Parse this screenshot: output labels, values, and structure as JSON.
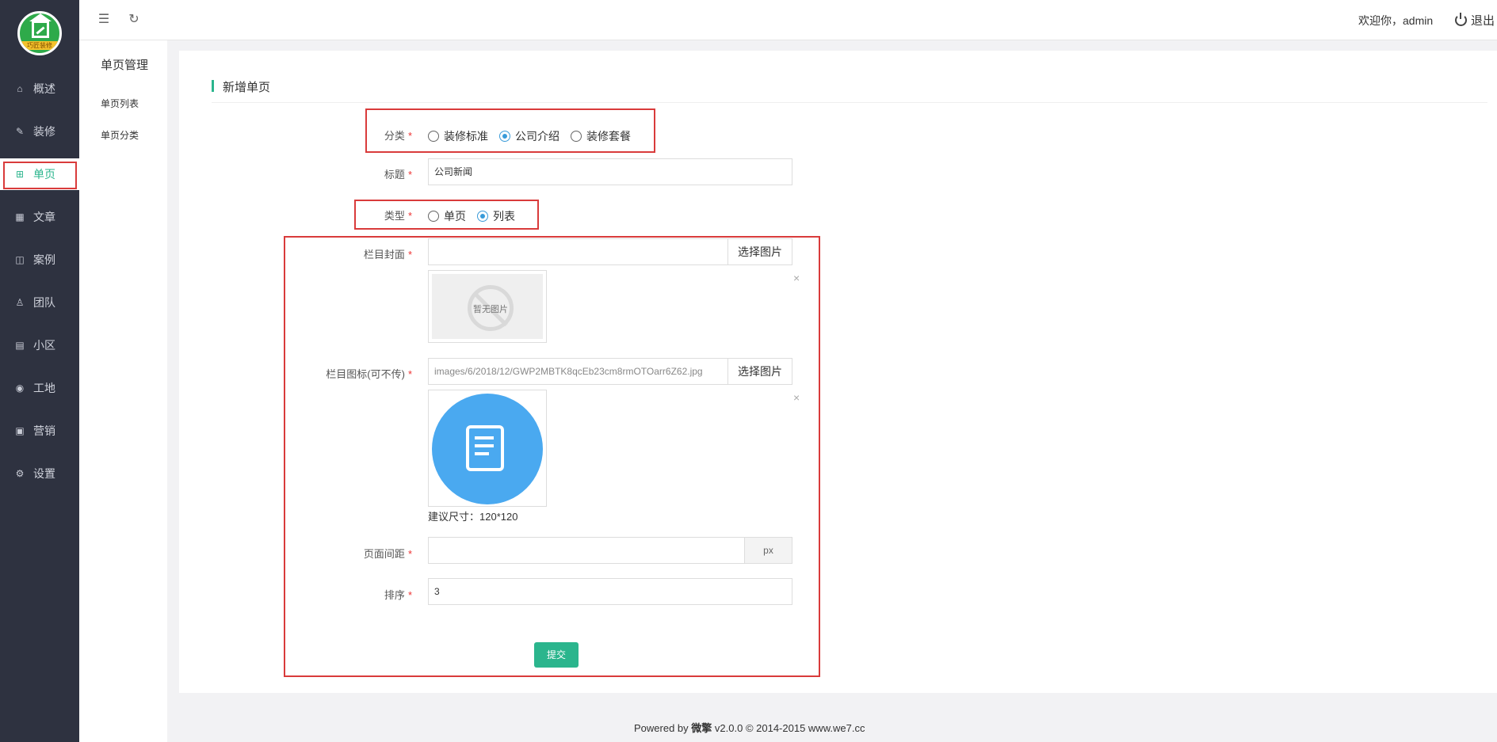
{
  "logo": {
    "brand": "巧匠装修"
  },
  "nav": [
    {
      "label": "概述",
      "icon": "home-icon"
    },
    {
      "label": "装修",
      "icon": "brush-icon"
    },
    {
      "label": "单页",
      "icon": "gift-icon"
    },
    {
      "label": "文章",
      "icon": "grid-icon"
    },
    {
      "label": "案例",
      "icon": "layout-icon"
    },
    {
      "label": "团队",
      "icon": "user-icon"
    },
    {
      "label": "小区",
      "icon": "building-icon"
    },
    {
      "label": "工地",
      "icon": "location-icon"
    },
    {
      "label": "营销",
      "icon": "ticket-icon"
    },
    {
      "label": "设置",
      "icon": "gear-icon"
    }
  ],
  "sub": {
    "title": "单页管理",
    "links": [
      "单页列表",
      "单页分类"
    ]
  },
  "topbar": {
    "welcome": "欢迎你，admin",
    "logout": "退出"
  },
  "page_title": "新增单页",
  "form": {
    "category": {
      "label": "分类",
      "options": [
        "装修标准",
        "公司介绍",
        "装修套餐"
      ],
      "selected": "公司介绍"
    },
    "title": {
      "label": "标题",
      "value": "公司新闻"
    },
    "type": {
      "label": "类型",
      "options": [
        "单页",
        "列表"
      ],
      "selected": "列表"
    },
    "cover": {
      "label": "栏目封面",
      "value": "",
      "button": "选择图片",
      "placeholder_img": "暂无图片"
    },
    "icon": {
      "label": "栏目图标(可不传)",
      "value": "images/6/2018/12/GWP2MBTK8qcEb23cm8rmOTOarr6Z62.jpg",
      "button": "选择图片",
      "hint": "建议尺寸：120*120"
    },
    "spacing": {
      "label": "页面间距",
      "value": "",
      "unit": "px"
    },
    "sort": {
      "label": "排序",
      "value": "3"
    },
    "submit": "提交",
    "required_mark": "*",
    "remove": "×"
  },
  "footer": {
    "prefix": "Powered by",
    "brand": "微擎",
    "rest": "v2.0.0 © 2014-2015 www.we7.cc"
  },
  "colors": {
    "sidebar": "#2e3240",
    "accent": "#2bb58d",
    "highlight": "#d93b3b",
    "radio": "#3a9bd9"
  }
}
